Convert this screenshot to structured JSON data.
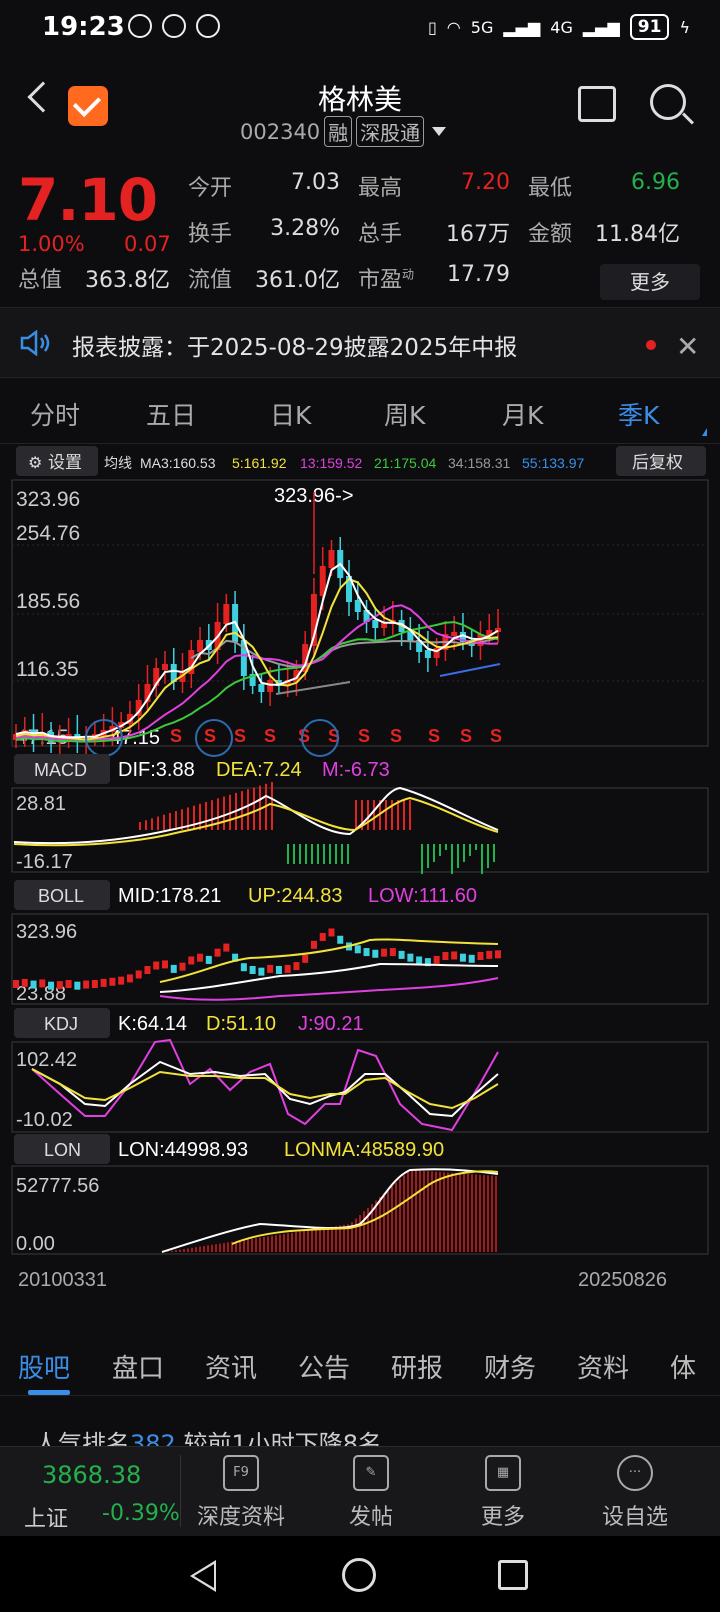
{
  "status_bar": {
    "time": "19:23",
    "network_5g": "5G",
    "network_4g": "4G",
    "battery": "91"
  },
  "header": {
    "stock_name": "格林美",
    "code": "002340",
    "tag_margin": "融",
    "tag_connect": "深股通"
  },
  "quote": {
    "price": "7.10",
    "change_pct": "1.00%",
    "change_amt": "0.07",
    "rows": [
      {
        "l1": "今开",
        "v1": "7.03",
        "l2": "最高",
        "v2": "7.20",
        "l3": "最低",
        "v3": "6.96"
      },
      {
        "l1": "换手",
        "v1": "3.28%",
        "l2": "总手",
        "v2": "167万",
        "l3": "金额",
        "v3": "11.84亿"
      },
      {
        "l1": "总值",
        "v1": "363.8亿",
        "l2": "流值",
        "v2": "361.0亿",
        "l3": "市盈",
        "l3sup": "动",
        "v3": "17.79"
      }
    ],
    "more": "更多"
  },
  "notice": {
    "text": "报表披露：于2025-08-29披露2025年中报"
  },
  "period_tabs": [
    "分时",
    "五日",
    "日K",
    "周K",
    "月K",
    "季K"
  ],
  "active_period": "季K",
  "chart": {
    "settings": "设置",
    "ma_label": "均线",
    "ma3": "MA3:160.53",
    "ma5": "5:161.92",
    "ma13": "13:159.52",
    "ma21": "21:175.04",
    "ma34": "34:158.31",
    "ma55": "55:133.97",
    "adjust": "后复权",
    "main_y": [
      "323.96",
      "254.76",
      "185.56",
      "116.35",
      "47.15"
    ],
    "high_marker": "323.96->",
    "low_marker": "47.15",
    "signal": "S",
    "macd": {
      "name": "MACD",
      "dif": "DIF:3.88",
      "dea": "DEA:7.24",
      "m": "M:-6.73",
      "y_top": "28.81",
      "y_bot": "-16.17"
    },
    "boll": {
      "name": "BOLL",
      "mid": "MID:178.21",
      "up": "UP:244.83",
      "low": "LOW:111.60",
      "y_top": "323.96",
      "y_bot": "23.88"
    },
    "kdj": {
      "name": "KDJ",
      "k": "K:64.14",
      "d": "D:51.10",
      "j": "J:90.21",
      "y_top": "102.42",
      "y_bot": "-10.02"
    },
    "lon": {
      "name": "LON",
      "lon": "LON:44998.93",
      "lonma": "LONMA:48589.90",
      "y_top": "52777.56",
      "y_bot": "0.00"
    },
    "date_start": "20100331",
    "date_end": "20250826"
  },
  "sub_tabs": [
    "股吧",
    "盘口",
    "资讯",
    "公告",
    "研报",
    "财务",
    "资料",
    "体"
  ],
  "popular": {
    "prefix": "人气排名",
    "rank": "382",
    "suffix": "较前1小时下降8名"
  },
  "bottom_bar": {
    "index_value": "3868.38",
    "index_name": "上证",
    "index_change": "-0.39%",
    "items": [
      {
        "label": "深度资料",
        "icon": "F9"
      },
      {
        "label": "发帖",
        "icon": "✎"
      },
      {
        "label": "更多",
        "icon": "▦"
      },
      {
        "label": "设自选",
        "icon": "···"
      }
    ]
  },
  "colors": {
    "up": "#e52222",
    "down": "#22b14c",
    "accent": "#3a8ee6",
    "ma5": "#f2e23a",
    "ma13": "#e040e0",
    "ma21": "#3cc83c",
    "ma34": "#999999",
    "ma55": "#3a8ee6"
  }
}
